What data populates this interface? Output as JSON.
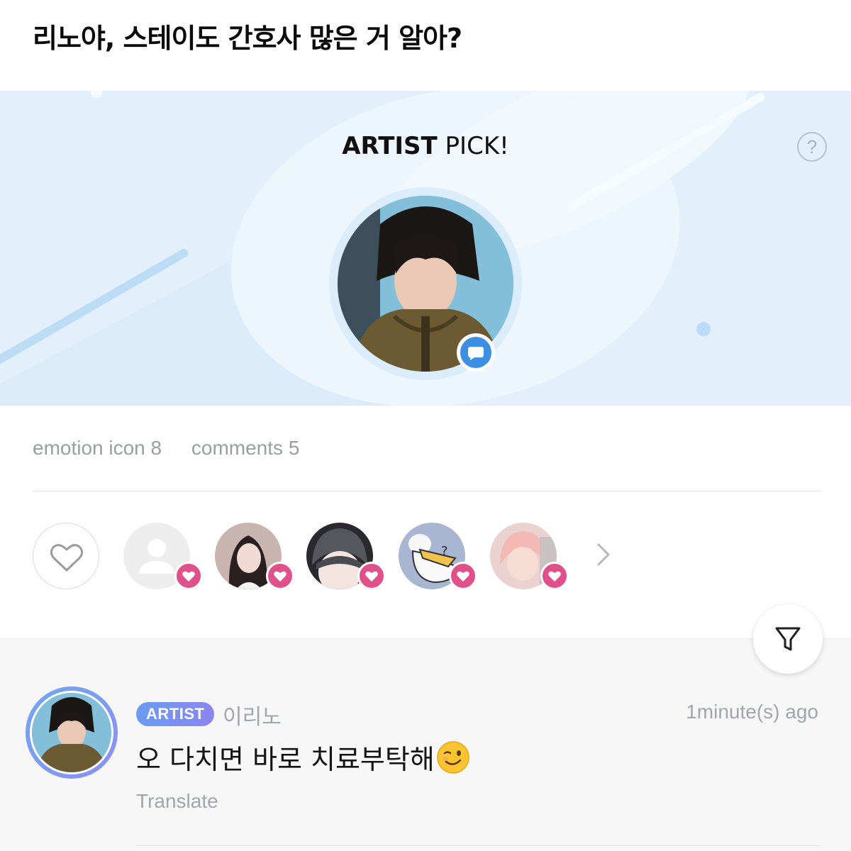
{
  "post": {
    "title": "리노야, 스테이도 간호사 많은 거 알아?"
  },
  "banner": {
    "title_bold": "ARTIST",
    "title_rest": " PICK!",
    "help_label": "?"
  },
  "stats": {
    "emotion_label": "emotion icon 8",
    "comments_label": "comments 5"
  },
  "likers": {
    "icons": [
      "heart-outline-icon",
      "default-avatar-icon",
      "heart-icon",
      "chevron-right-icon"
    ],
    "colors": {
      "heart_badge": "#e0508a"
    }
  },
  "comment": {
    "badge": "ARTIST",
    "author": "이리노",
    "time": "1minute(s) ago",
    "text": "오 다치면 바로 치료부탁해",
    "emoji": "winking-face-emoji",
    "translate": "Translate"
  },
  "colors": {
    "banner_bg": "#e3f0fb",
    "accent_blue": "#3d8fe4",
    "badge_gradient_start": "#6a9cf2",
    "badge_gradient_end": "#8c86f0",
    "muted_text": "#a2a5aa"
  }
}
